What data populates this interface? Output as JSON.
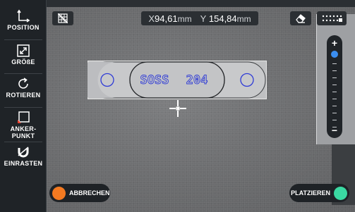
{
  "toolbar": {
    "items": [
      {
        "label": "POSITION",
        "icon": "move-axes-icon"
      },
      {
        "label": "GRÖßE",
        "icon": "resize-icon"
      },
      {
        "label": "ROTIEREN",
        "icon": "rotate-icon"
      },
      {
        "label": "ANKER-\nPUNKT",
        "icon": "anchor-point-icon"
      },
      {
        "label": "EINRASTEN",
        "icon": "magnet-icon"
      }
    ]
  },
  "coords": {
    "x_axis": "X",
    "x_value": "94,61",
    "x_unit": "mm",
    "y_axis": "Y",
    "y_value": "154,84",
    "y_unit": "mm"
  },
  "stamp": {
    "text_left": "SOSS",
    "text_right": "204",
    "text_color": "#2f3bd6"
  },
  "zoom": {
    "plus": "+",
    "minus": "−",
    "level": 0.0
  },
  "buttons": {
    "cancel_label": "ABBRECHEN",
    "cancel_color": "#f47a21",
    "place_label": "PLATZIEREN",
    "place_color": "#3ad9a2"
  }
}
